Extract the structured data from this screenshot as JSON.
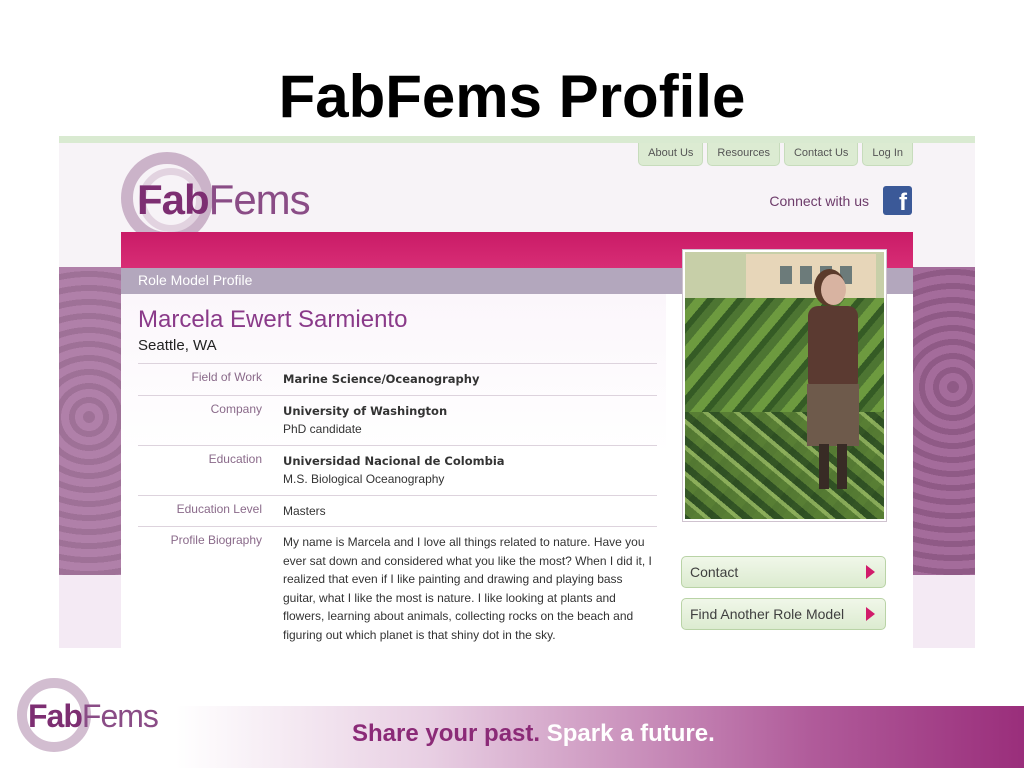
{
  "slide": {
    "title": "FabFems Profile",
    "footer_logo": {
      "fab": "Fab",
      "fems": "Fems"
    },
    "tagline_part1": "Share your past.",
    "tagline_part2": "Spark a future."
  },
  "site": {
    "logo": {
      "fab": "Fab",
      "fems": "Fems"
    },
    "nav": [
      "About Us",
      "Resources",
      "Contact Us",
      "Log In"
    ],
    "connect_label": "Connect with us",
    "facebook_glyph": "f",
    "section_header": "Role Model Profile"
  },
  "profile": {
    "name": "Marcela Ewert Sarmiento",
    "location": "Seattle, WA",
    "fields": [
      {
        "label": "Field of Work",
        "value": "Marine Science/Oceanography",
        "sub": ""
      },
      {
        "label": "Company",
        "value": "University of Washington",
        "sub": "PhD candidate"
      },
      {
        "label": "Education",
        "value": "Universidad Nacional de Colombia",
        "sub": "M.S. Biological Oceanography"
      },
      {
        "label": "Education Level",
        "value": "",
        "sub": "Masters"
      },
      {
        "label": "Profile Biography",
        "value": "",
        "sub": "My name is Marcela and I love all things related to nature. Have you ever sat down and considered what you like the most? When I did it, I realized that even if I like painting and drawing and playing bass guitar, what I like the most is nature. I like looking at plants and flowers, learning about animals, collecting rocks on the beach and figuring out which planet is that shiny dot in the sky."
      }
    ]
  },
  "actions": {
    "contact": "Contact",
    "find_another": "Find Another Role Model"
  },
  "colors": {
    "brand_purple": "#8a3a89",
    "accent_magenta": "#d11b6b",
    "nav_green": "#dcebd2",
    "facebook_blue": "#3b5998"
  }
}
